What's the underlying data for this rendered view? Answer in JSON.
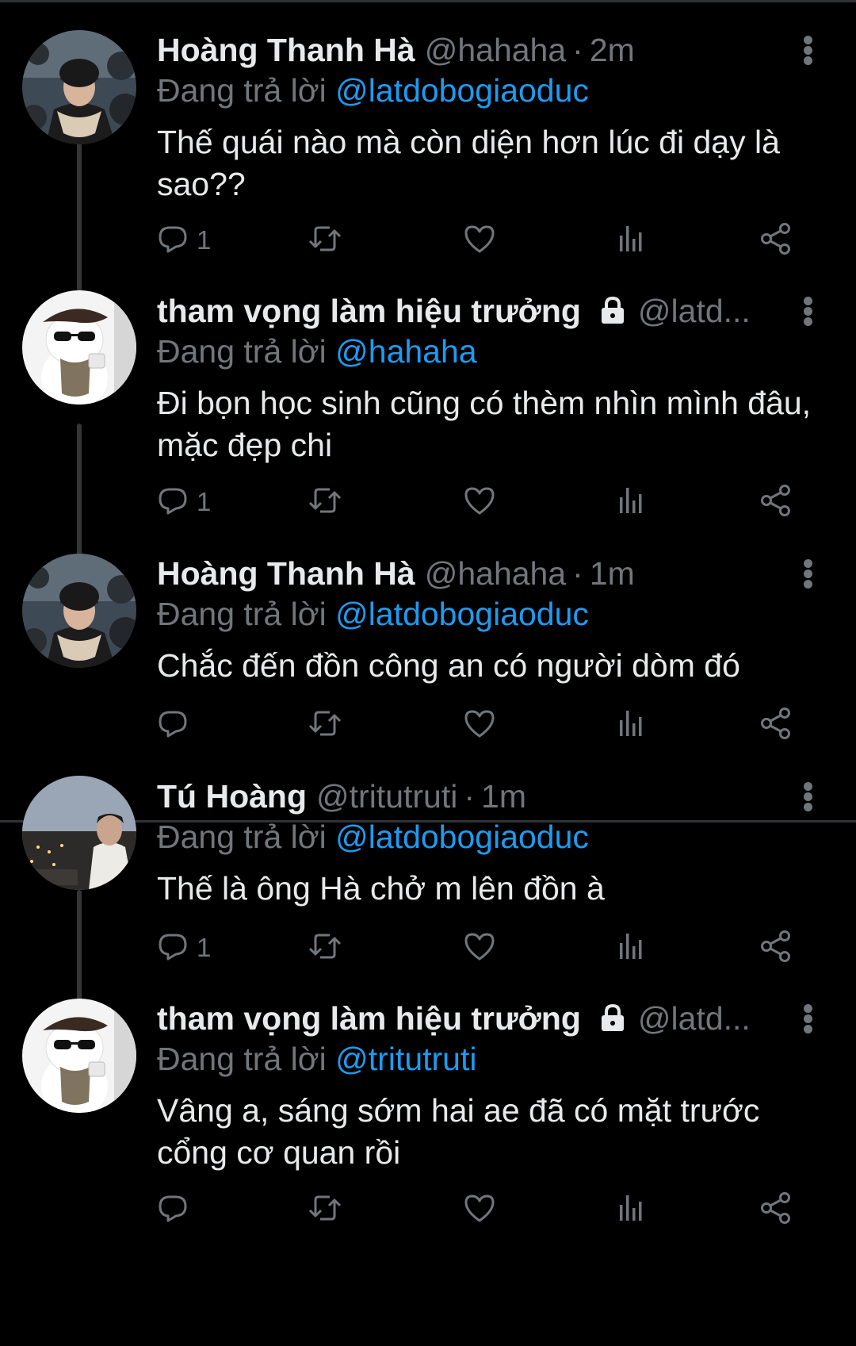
{
  "colors": {
    "background": "#000000",
    "text": "#e7e9ea",
    "secondary": "#71767b",
    "link": "#1d9bf0",
    "thread_line": "#333639",
    "divider": "#2f3336"
  },
  "tweets": [
    {
      "name": "Hoàng Thanh Hà",
      "handle": "@hahaha",
      "separator": "·",
      "time": "2m",
      "replying_prefix": "Đang trả lời",
      "replying_to": "@latdobogiaoduc",
      "text": "Thế quái nào mà còn diện hơn lúc đi dạy là sao??",
      "reply_count": "1",
      "avatar_icon": "avatar-boy-beanie",
      "locked": false
    },
    {
      "name": "tham vọng làm hiệu trưởng",
      "handle": "@latd...",
      "separator": "",
      "time": "",
      "replying_prefix": "Đang trả lời",
      "replying_to": "@hahaha",
      "text": "Đi bọn học sinh cũng có thèm nhìn mình đâu, mặc đẹp chi",
      "reply_count": "1",
      "avatar_icon": "avatar-cat-sunglasses",
      "locked": true
    },
    {
      "name": "Hoàng Thanh Hà",
      "handle": "@hahaha",
      "separator": "·",
      "time": "1m",
      "replying_prefix": "Đang trả lời",
      "replying_to": "@latdobogiaoduc",
      "text": "Chắc đến đồn công an có người dòm đó",
      "reply_count": "",
      "avatar_icon": "avatar-boy-beanie",
      "locked": false
    },
    {
      "name": "Tú Hoàng",
      "handle": "@tritutruti",
      "separator": "·",
      "time": "1m",
      "replying_prefix": "Đang trả lời",
      "replying_to": "@latdobogiaoduc",
      "text": "Thế là ông Hà chở m lên đồn à",
      "reply_count": "1",
      "avatar_icon": "avatar-city-night",
      "locked": false
    },
    {
      "name": "tham vọng làm hiệu trưởng",
      "handle": "@latd...",
      "separator": "",
      "time": "",
      "replying_prefix": "Đang trả lời",
      "replying_to": "@tritutruti",
      "text": "Vâng a, sáng sớm hai ae đã có mặt trước cổng cơ quan rồi",
      "reply_count": "",
      "avatar_icon": "avatar-cat-sunglasses",
      "locked": true
    }
  ],
  "action_icons": [
    "reply-icon",
    "retweet-icon",
    "like-icon",
    "views-icon",
    "share-icon"
  ]
}
